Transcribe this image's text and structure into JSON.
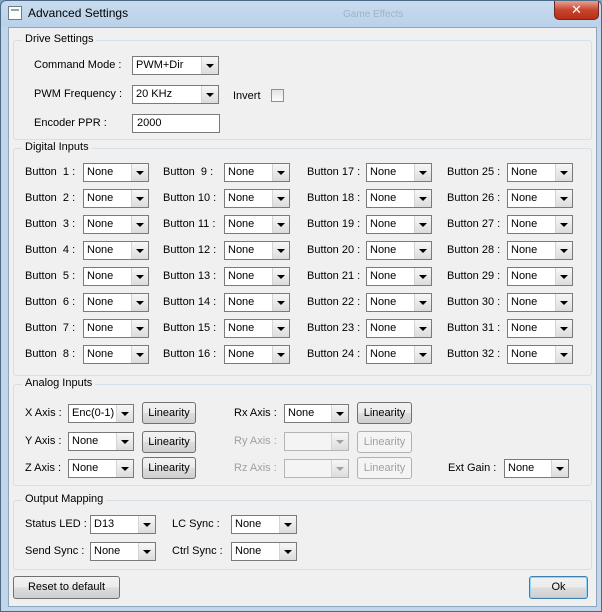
{
  "window": {
    "title": "Advanced Settings",
    "background_text": "Game Effects",
    "close": "✕"
  },
  "drive": {
    "title": "Drive Settings",
    "command_mode_label": "Command Mode :",
    "command_mode": "PWM+Dir",
    "pwm_freq_label": "PWM Frequency :",
    "pwm_freq": "20 KHz",
    "invert_label": "Invert",
    "invert_checked": false,
    "encoder_ppr_label": "Encoder PPR :",
    "encoder_ppr": "2000"
  },
  "digital": {
    "title": "Digital Inputs",
    "buttons": [
      {
        "label": "Button  1 :",
        "value": "None"
      },
      {
        "label": "Button  2 :",
        "value": "None"
      },
      {
        "label": "Button  3 :",
        "value": "None"
      },
      {
        "label": "Button  4 :",
        "value": "None"
      },
      {
        "label": "Button  5 :",
        "value": "None"
      },
      {
        "label": "Button  6 :",
        "value": "None"
      },
      {
        "label": "Button  7 :",
        "value": "None"
      },
      {
        "label": "Button  8 :",
        "value": "None"
      },
      {
        "label": "Button  9 :",
        "value": "None"
      },
      {
        "label": "Button 10 :",
        "value": "None"
      },
      {
        "label": "Button 11 :",
        "value": "None"
      },
      {
        "label": "Button 12 :",
        "value": "None"
      },
      {
        "label": "Button 13 :",
        "value": "None"
      },
      {
        "label": "Button 14 :",
        "value": "None"
      },
      {
        "label": "Button 15 :",
        "value": "None"
      },
      {
        "label": "Button 16 :",
        "value": "None"
      },
      {
        "label": "Button 17 :",
        "value": "None"
      },
      {
        "label": "Button 18 :",
        "value": "None"
      },
      {
        "label": "Button 19 :",
        "value": "None"
      },
      {
        "label": "Button 20 :",
        "value": "None"
      },
      {
        "label": "Button 21 :",
        "value": "None"
      },
      {
        "label": "Button 22 :",
        "value": "None"
      },
      {
        "label": "Button 23 :",
        "value": "None"
      },
      {
        "label": "Button 24 :",
        "value": "None"
      },
      {
        "label": "Button 25 :",
        "value": "None"
      },
      {
        "label": "Button 26 :",
        "value": "None"
      },
      {
        "label": "Button 27 :",
        "value": "None"
      },
      {
        "label": "Button 28 :",
        "value": "None"
      },
      {
        "label": "Button 29 :",
        "value": "None"
      },
      {
        "label": "Button 30 :",
        "value": "None"
      },
      {
        "label": "Button 31 :",
        "value": "None"
      },
      {
        "label": "Button 32 :",
        "value": "None"
      }
    ]
  },
  "analog": {
    "title": "Analog Inputs",
    "linearity_label": "Linearity",
    "x_label": "X Axis :",
    "x_value": "Enc(0-1)",
    "y_label": "Y Axis :",
    "y_value": "None",
    "z_label": "Z Axis :",
    "z_value": "None",
    "rx_label": "Rx Axis :",
    "rx_value": "None",
    "ry_label": "Ry Axis :",
    "ry_value": "",
    "rz_label": "Rz Axis :",
    "rz_value": "",
    "ext_gain_label": "Ext Gain :",
    "ext_gain_value": "None"
  },
  "output": {
    "title": "Output Mapping",
    "status_led_label": "Status LED :",
    "status_led": "D13",
    "send_sync_label": "Send Sync :",
    "send_sync": "None",
    "lc_sync_label": "LC Sync :",
    "lc_sync": "None",
    "ctrl_sync_label": "Ctrl Sync :",
    "ctrl_sync": "None"
  },
  "footer": {
    "reset_label": "Reset to default",
    "ok_label": "Ok"
  }
}
